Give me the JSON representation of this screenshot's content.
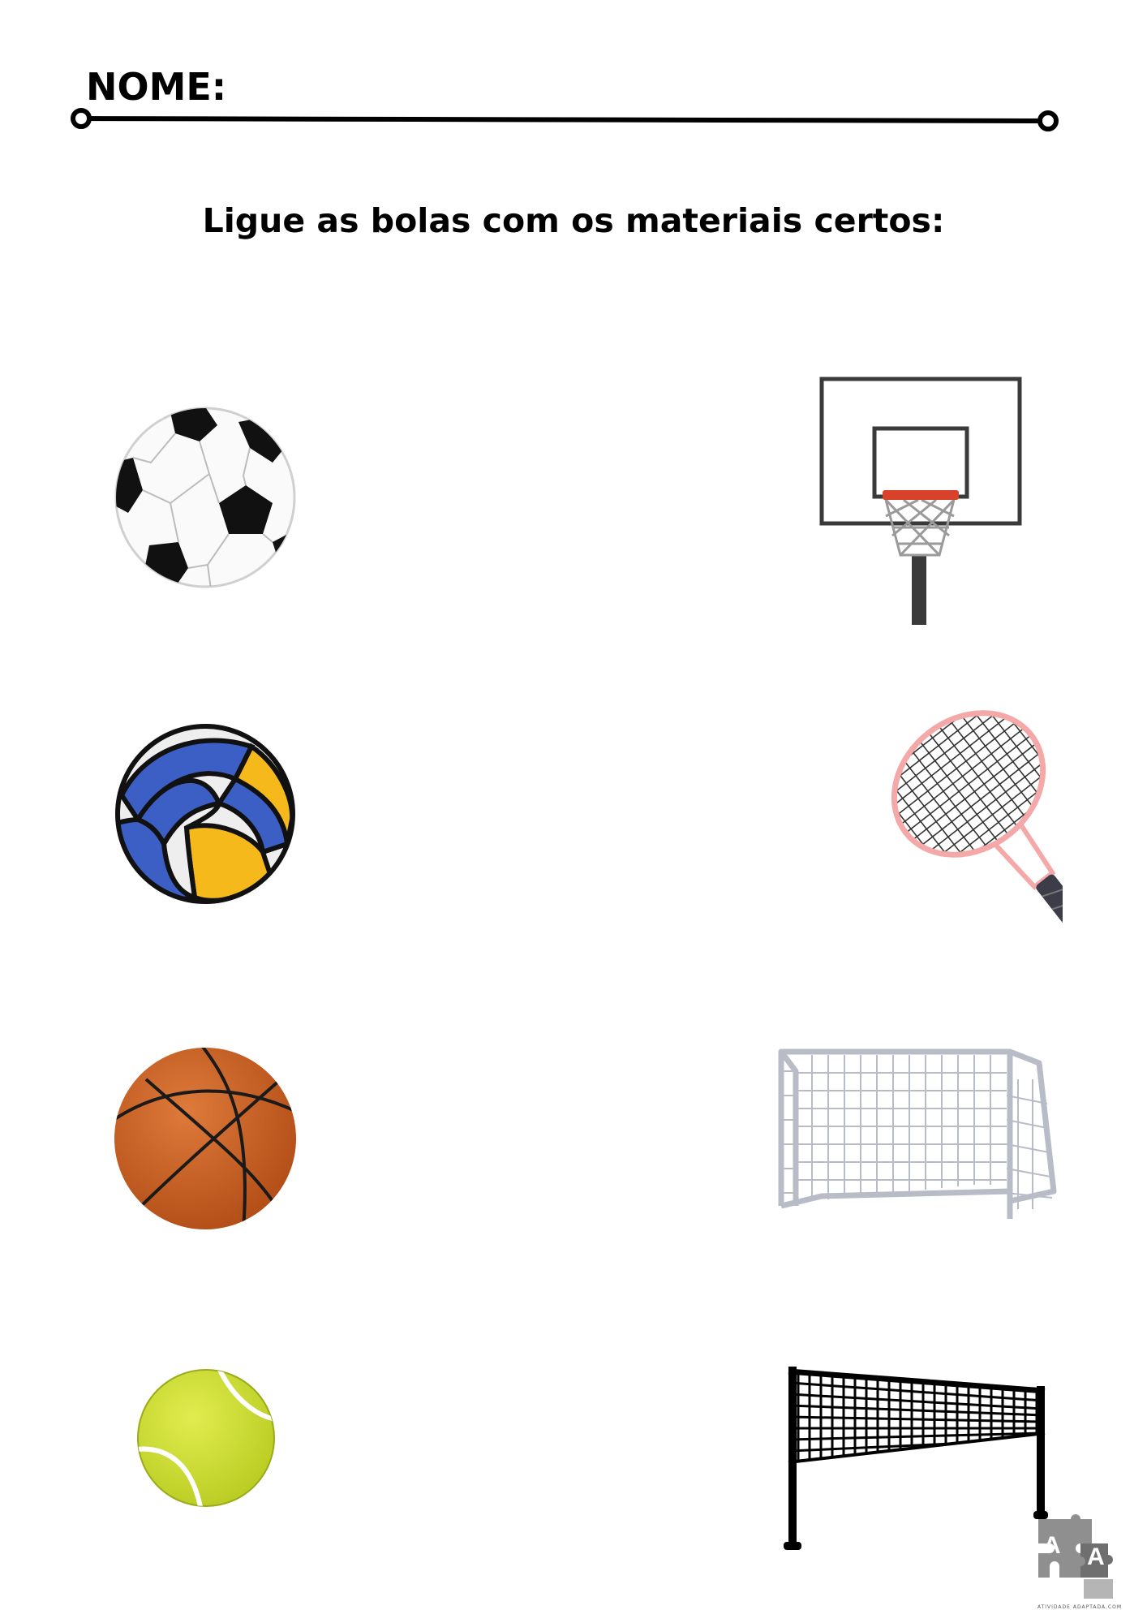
{
  "header": {
    "name_label": "NOME:"
  },
  "instruction": "Ligue as bolas com os materiais certos:",
  "balls": [
    {
      "icon": "soccer-ball-icon"
    },
    {
      "icon": "volleyball-icon"
    },
    {
      "icon": "basketball-icon"
    },
    {
      "icon": "tennis-ball-icon"
    }
  ],
  "materials": [
    {
      "icon": "basketball-hoop-icon"
    },
    {
      "icon": "tennis-racket-icon"
    },
    {
      "icon": "soccer-goal-icon"
    },
    {
      "icon": "volleyball-net-icon"
    }
  ],
  "logo": {
    "letters": [
      "A",
      "A"
    ],
    "caption": "ATIVIDADE ADAPTADA.COM"
  },
  "colors": {
    "basketball": "#c65a1e",
    "tennis_ball": "#d2e23c",
    "volleyball_blue": "#3b5fc4",
    "volleyball_yellow": "#f6b91b",
    "hoop_rim": "#d9412a",
    "racket_frame": "#f4a9a8"
  }
}
